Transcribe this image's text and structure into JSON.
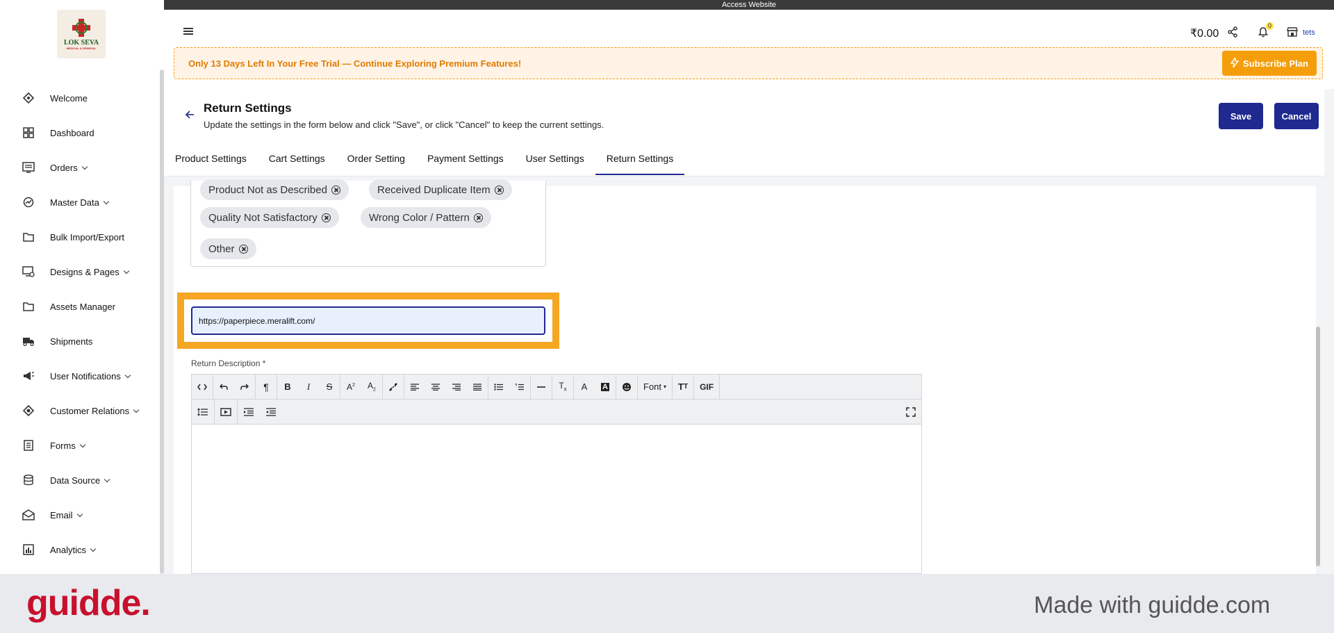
{
  "topbar": {
    "label": "Access Website"
  },
  "logo": {
    "name": "LOK SEVA",
    "sub": "MEDICAL & GENERAL"
  },
  "sidebar": {
    "items": [
      {
        "label": "Welcome",
        "icon": "welcome-icon",
        "chevron": false
      },
      {
        "label": "Dashboard",
        "icon": "dashboard-icon",
        "chevron": false
      },
      {
        "label": "Orders",
        "icon": "orders-icon",
        "chevron": true
      },
      {
        "label": "Master Data",
        "icon": "master-data-icon",
        "chevron": true
      },
      {
        "label": "Bulk Import/Export",
        "icon": "folder-icon",
        "chevron": false
      },
      {
        "label": "Designs & Pages",
        "icon": "designs-icon",
        "chevron": true
      },
      {
        "label": "Assets Manager",
        "icon": "folder-icon",
        "chevron": false
      },
      {
        "label": "Shipments",
        "icon": "truck-icon",
        "chevron": false
      },
      {
        "label": "User Notifications",
        "icon": "megaphone-icon",
        "chevron": true
      },
      {
        "label": "Customer Relations",
        "icon": "customer-icon",
        "chevron": true
      },
      {
        "label": "Forms",
        "icon": "forms-icon",
        "chevron": true
      },
      {
        "label": "Data Source",
        "icon": "database-icon",
        "chevron": true
      },
      {
        "label": "Email",
        "icon": "email-icon",
        "chevron": true
      },
      {
        "label": "Analytics",
        "icon": "analytics-icon",
        "chevron": true
      }
    ]
  },
  "header": {
    "balance": "₹0.00",
    "notification_count": "0",
    "store_label": "tets"
  },
  "trial": {
    "text": "Only 13 Days Left In Your Free Trial — Continue Exploring Premium Features!",
    "subscribe_label": "Subscribe Plan"
  },
  "page": {
    "title": "Return Settings",
    "subtitle": "Update the settings in the form below and click \"Save\", or click \"Cancel\" to keep the current settings.",
    "save_label": "Save",
    "cancel_label": "Cancel"
  },
  "tabs": [
    {
      "label": "Product Settings",
      "active": false
    },
    {
      "label": "Cart Settings",
      "active": false
    },
    {
      "label": "Order Setting",
      "active": false
    },
    {
      "label": "Payment Settings",
      "active": false
    },
    {
      "label": "User Settings",
      "active": false
    },
    {
      "label": "Return Settings",
      "active": true
    }
  ],
  "reasons": {
    "chips": [
      "Product Not as Described",
      "Received Duplicate Item",
      "Quality Not Satisfactory",
      "Wrong Color / Pattern",
      "Other"
    ]
  },
  "url_field": {
    "value": "https://paperpiece.meralift.com/"
  },
  "return_description": {
    "label": "Return Description *",
    "font_label": "Font",
    "gif_label": "GIF"
  },
  "footer": {
    "logo": "guidde.",
    "made_with": "Made with guidde.com"
  },
  "colors": {
    "accent": "#1e2a8f",
    "highlight": "#f5a623",
    "trial_text": "#e07b00",
    "guidde_red": "#c8102e"
  }
}
